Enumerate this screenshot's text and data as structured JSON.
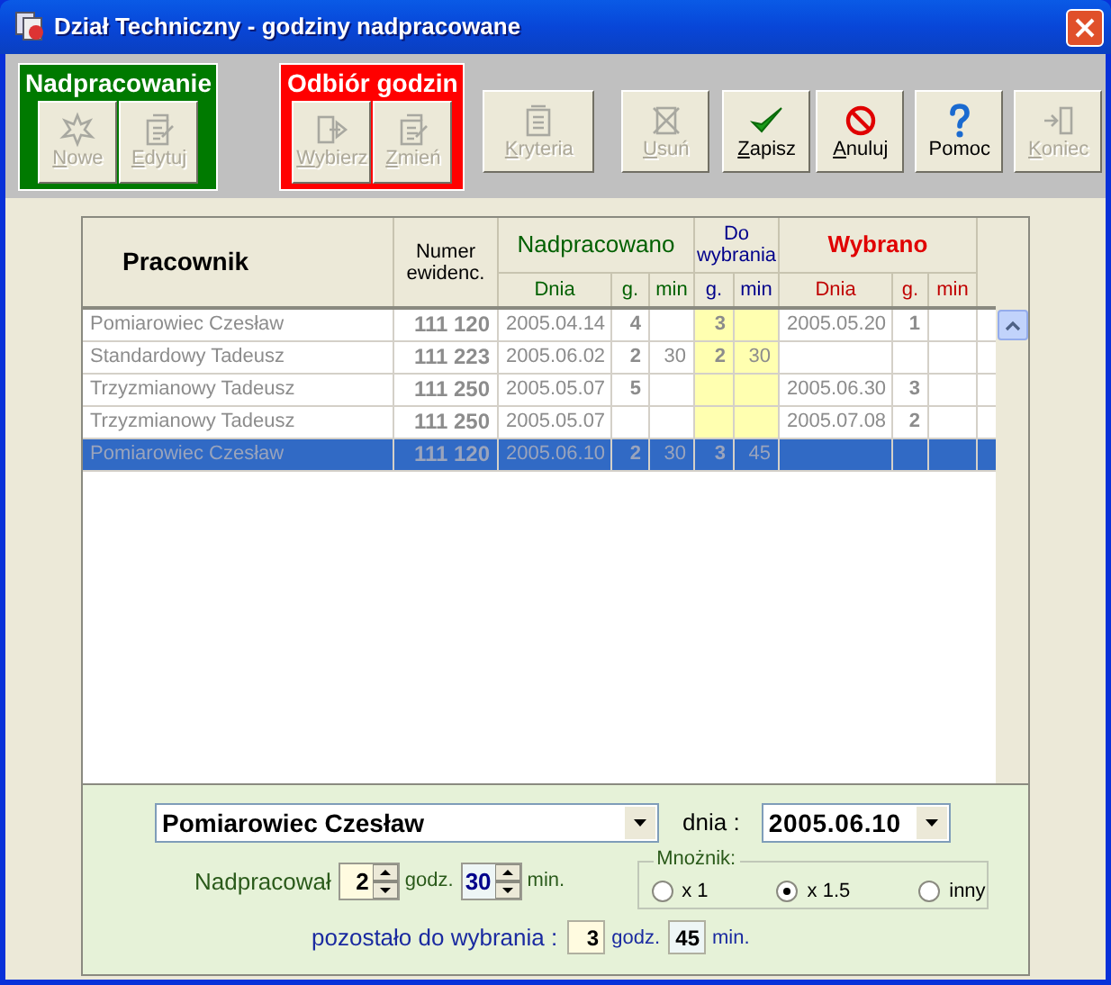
{
  "window": {
    "title": "Dział Techniczny - godziny nadpracowane"
  },
  "toolbar": {
    "groups": [
      {
        "title": "Nadpracowanie",
        "color": "#007a00",
        "buttons": [
          {
            "label": "Nowe",
            "kind": "new",
            "disabled": true,
            "mnemonic": true
          },
          {
            "label": "Edytuj",
            "kind": "edit",
            "disabled": true,
            "mnemonic": true
          }
        ]
      },
      {
        "title": "Odbiór godzin",
        "color": "#ff0000",
        "buttons": [
          {
            "label": "Wybierz",
            "kind": "pick",
            "disabled": true,
            "mnemonic": true
          },
          {
            "label": "Zmień",
            "kind": "edit",
            "disabled": true,
            "mnemonic": true
          }
        ]
      }
    ],
    "buttons": [
      {
        "label": "Kryteria",
        "kind": "criteria",
        "disabled": true,
        "mnemonic": true
      },
      {
        "label": "Usuń",
        "kind": "delete",
        "disabled": true,
        "mnemonic": true
      },
      {
        "label": "Zapisz",
        "kind": "check",
        "disabled": false,
        "mnemonic": true
      },
      {
        "label": "Anuluj",
        "kind": "cancel",
        "disabled": false,
        "mnemonic": true
      },
      {
        "label": "Pomoc",
        "kind": "help",
        "disabled": false,
        "mnemonic": false
      },
      {
        "label": "Koniec",
        "kind": "exit",
        "disabled": true,
        "mnemonic": true
      }
    ]
  },
  "table": {
    "header": {
      "employee": "Pracownik",
      "number": "Numer ewidenc.",
      "worked": "Nadpracowano",
      "remaining": "Do wybrania",
      "taken": "Wybrano",
      "sub": [
        "Dnia",
        "g.",
        "min",
        "g.",
        "min",
        "Dnia",
        "g.",
        "min"
      ]
    },
    "rows": [
      {
        "name": "Pomiarowiec Czesław",
        "number": "111 120",
        "date": "2005.04.14",
        "h": "4",
        "m": "",
        "rh": "3",
        "rm": "",
        "tdate": "2005.05.20",
        "th": "1",
        "tm": "",
        "selected": false
      },
      {
        "name": "Standardowy Tadeusz",
        "number": "111 223",
        "date": "2005.06.02",
        "h": "2",
        "m": "30",
        "rh": "2",
        "rm": "30",
        "tdate": "",
        "th": "",
        "tm": "",
        "selected": false
      },
      {
        "name": "Trzyzmianowy Tadeusz",
        "number": "111 250",
        "date": "2005.05.07",
        "h": "5",
        "m": "",
        "rh": "",
        "rm": "",
        "tdate": "2005.06.30",
        "th": "3",
        "tm": "",
        "selected": false
      },
      {
        "name": "Trzyzmianowy Tadeusz",
        "number": "111 250",
        "date": "2005.05.07",
        "h": "",
        "m": "",
        "rh": "",
        "rm": "",
        "tdate": "2005.07.08",
        "th": "2",
        "tm": "",
        "selected": false
      },
      {
        "name": "Pomiarowiec Czesław",
        "number": "111 120",
        "date": "2005.06.10",
        "h": "2",
        "m": "30",
        "rh": "3",
        "rm": "45",
        "tdate": "",
        "th": "",
        "tm": "",
        "selected": true
      }
    ]
  },
  "form": {
    "employee": "Pomiarowiec Czesław",
    "date_label": "dnia :",
    "date": "2005.06.10",
    "worked_label": "Nadpracował",
    "hours": "2",
    "hours_unit": "godz.",
    "minutes": "30",
    "minutes_unit": "min.",
    "multiplier": {
      "title": "Mnożnik:",
      "options": [
        {
          "label": "x 1",
          "selected": false
        },
        {
          "label": "x 1.5",
          "selected": true
        },
        {
          "label": "inny",
          "selected": false
        }
      ]
    },
    "remaining_label": "pozostało do wybrania :",
    "remaining_hours": "3",
    "remaining_hours_unit": "godz.",
    "remaining_minutes": "45",
    "remaining_minutes_unit": "min."
  }
}
